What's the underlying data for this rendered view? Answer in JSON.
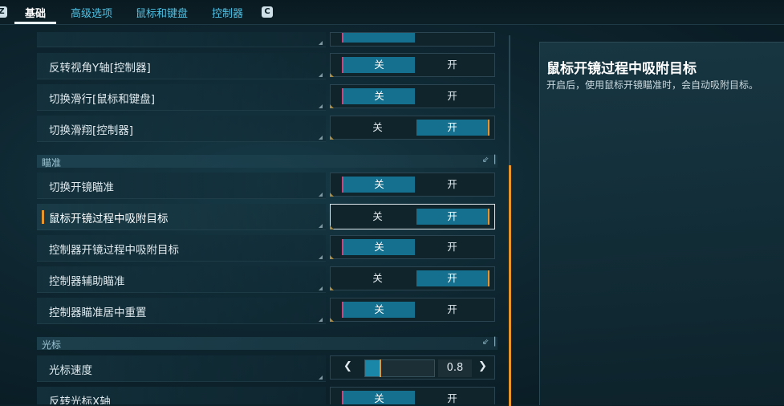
{
  "tabs": {
    "left_key": "Z",
    "right_key": "C",
    "items": [
      "基础",
      "高级选项",
      "鼠标和键盘",
      "控制器"
    ],
    "active_index": 0
  },
  "settings": {
    "rows": [
      {
        "label": "反转视角Y轴[控制器]",
        "off": "关",
        "on": "开",
        "state": "off"
      },
      {
        "label": "切换滑行[鼠标和键盘]",
        "off": "关",
        "on": "开",
        "state": "off"
      },
      {
        "label": "切换滑翔[控制器]",
        "off": "关",
        "on": "开",
        "state": "on"
      },
      {
        "label": "切换开镜瞄准",
        "off": "关",
        "on": "开",
        "state": "off"
      },
      {
        "label": "鼠标开镜过程中吸附目标",
        "off": "关",
        "on": "开",
        "state": "on"
      },
      {
        "label": "控制器开镜过程中吸附目标",
        "off": "关",
        "on": "开",
        "state": "off"
      },
      {
        "label": "控制器辅助瞄准",
        "off": "关",
        "on": "开",
        "state": "on"
      },
      {
        "label": "控制器瞄准居中重置",
        "off": "关",
        "on": "开",
        "state": "off"
      },
      {
        "label": "反转光标X轴",
        "off": "关",
        "on": "开",
        "state": "off"
      }
    ],
    "sections": {
      "aim": "瞄准",
      "cursor": "光标"
    },
    "cursor_speed": {
      "label": "光标速度",
      "value": "0.8",
      "fraction": 0.22
    },
    "selected_index": 4
  },
  "description": {
    "title": "鼠标开镜过程中吸附目标",
    "body": "开启后，使用鼠标开镜瞄准时，会自动吸附目标。"
  },
  "colors": {
    "accent": "#e8962c",
    "toggle_on": "#14708e",
    "off_marker": "#c8457a",
    "tab_text": "#4fc3e6"
  }
}
